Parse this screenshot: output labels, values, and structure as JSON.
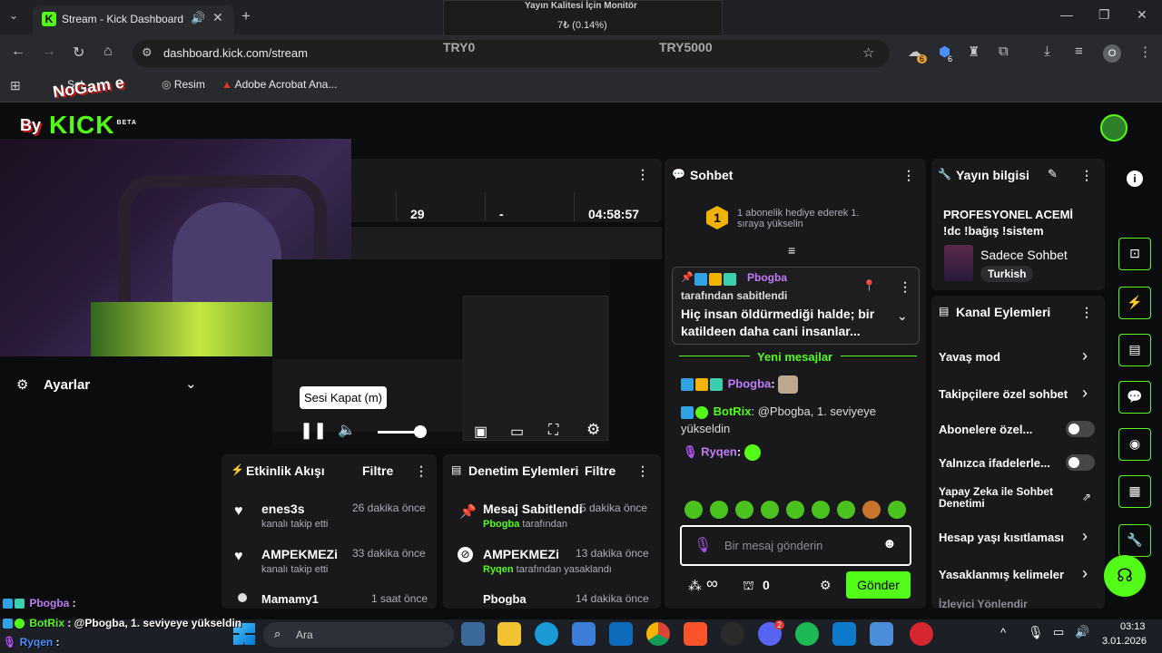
{
  "browser": {
    "tab_title": "Stream - Kick Dashboard",
    "url": "dashboard.kick.com/stream",
    "bookmarks": [
      "Sel",
      "Resim",
      "Adobe Acrobat Ana..."
    ],
    "profile_initial": "O",
    "ext_badges": [
      "6",
      "6"
    ]
  },
  "overlay": {
    "monitor_title": "Yayın Kalitesi İçin Monitör",
    "monitor_value": "7₺ (0.14%)",
    "try_left": "TRY0",
    "try_right": "TRY5000",
    "brand_text": "NoGam e",
    "brand_by": "By",
    "kick_logo": "KICK",
    "beta": "BETA"
  },
  "stats": {
    "viewers": "29",
    "dash": "-",
    "duration": "04:58:57"
  },
  "player": {
    "tooltip": "Sesi Kapat (m)"
  },
  "settings_label": "Ayarlar",
  "activity": {
    "title": "Etkinlik Akışı",
    "filter": "Filtre",
    "items": [
      {
        "name": "enes3s",
        "sub": "kanalı takip etti",
        "time": "26 dakika önce"
      },
      {
        "name": "AMPEKMEZi",
        "sub": "kanalı takip etti",
        "time": "33 dakika önce"
      },
      {
        "name": "Mamamy1",
        "sub": "",
        "time": "1 saat önce"
      }
    ]
  },
  "moderation": {
    "title": "Denetim Eylemleri",
    "filter": "Filtre",
    "items": [
      {
        "name": "Mesaj Sabitlendi",
        "who": "Pbogba",
        "sub": " tarafından",
        "time": "5 dakika önce"
      },
      {
        "name": "AMPEKMEZi",
        "who": "Ryqen",
        "sub": " tarafından yasaklandı",
        "time": "13 dakika önce"
      },
      {
        "name": "Pbogba",
        "who": "",
        "sub": "",
        "time": "14 dakika önce"
      }
    ]
  },
  "chat": {
    "title": "Sohbet",
    "goal_number": "1",
    "goal_text": "1 abonelik hediye ederek 1. sıraya yükselin",
    "pinned_user": "Pbogba",
    "pinned_by": "tarafından sabitlendi",
    "pinned_text": "Hiç insan öldürmediği halde; bir katildeen daha cani insanlar...",
    "new_messages": "Yeni mesajlar",
    "messages": [
      {
        "user": "Pbogba",
        "text": ":",
        "color": "#c07cf8"
      },
      {
        "user": "BotRix",
        "text": ": @Pbogba, 1. seviyeye yükseldin",
        "color": "#53fc18"
      },
      {
        "user": "Ryqen",
        "text": ":",
        "color": "#c07cf8"
      }
    ],
    "input_placeholder": "Bir mesaj gönderin",
    "infinity": "∞",
    "count": "0",
    "send": "Gönder"
  },
  "stream_info": {
    "title": "Yayın bilgisi",
    "stream_title": "PROFESYONEL ACEMİ !dc !bağış !sistem",
    "category": "Sadece Sohbet",
    "language": "Turkish"
  },
  "channel_actions": {
    "title": "Kanal Eylemleri",
    "items": [
      {
        "label": "Yavaş mod",
        "control": "chevron"
      },
      {
        "label": "Takipçilere özel sohbet",
        "control": "chevron"
      },
      {
        "label": "Abonelere özel...",
        "control": "toggle"
      },
      {
        "label": "Yalnızca ifadelerle...",
        "control": "toggle"
      },
      {
        "label": "Yapay Zeka ile Sohbet Denetimi",
        "control": "external"
      },
      {
        "label": "Hesap yaşı kısıtlaması",
        "control": "chevron"
      },
      {
        "label": "Yasaklanmış kelimeler",
        "control": "chevron"
      },
      {
        "label": "İzleyici Yönlendir",
        "control": "chevron"
      }
    ]
  },
  "overlay_chat": [
    {
      "user": "Pbogba",
      "text": " :",
      "color": "#c07cf8"
    },
    {
      "user": "BotRix",
      "text": " : @Pbogba, 1. seviyeye yükseldin",
      "color": "#53fc18"
    },
    {
      "user": "Ryqen",
      "text": " :",
      "color": "#4a90ff"
    }
  ],
  "taskbar": {
    "search": "Ara",
    "time": "03:13",
    "date": "3.01.2026",
    "discord_badge": "2"
  },
  "colors": {
    "accent": "#53fc18",
    "panel": "#19191b",
    "bg": "#0b0c0d"
  }
}
